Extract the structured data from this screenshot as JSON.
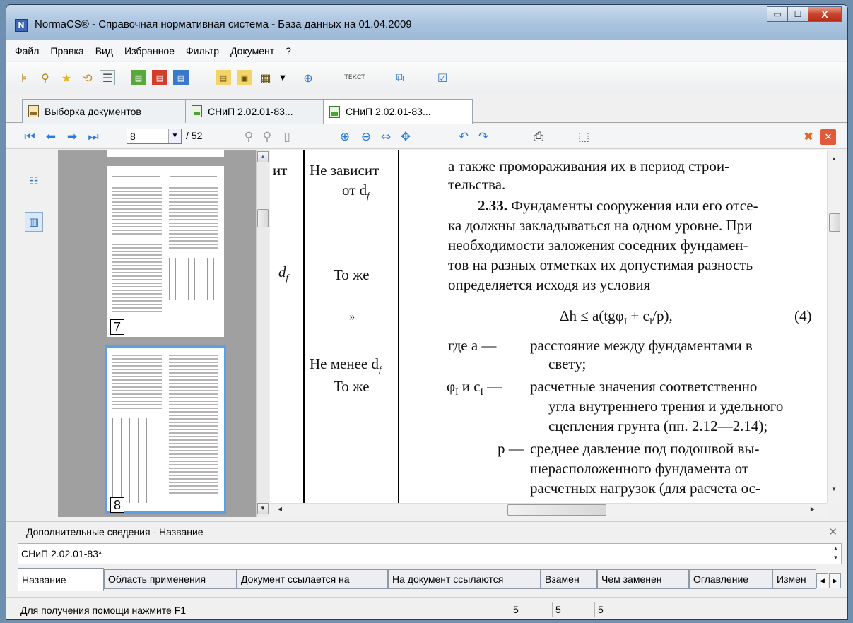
{
  "window": {
    "title": "NormaCS® - Справочная нормативная система - База данных на 01.04.2009"
  },
  "window_controls": {
    "minimize": "▭",
    "maximize": "☐",
    "close": "X"
  },
  "menu": [
    "Файл",
    "Правка",
    "Вид",
    "Избранное",
    "Фильтр",
    "Документ",
    "?"
  ],
  "toolbar_icons": [
    "tree-icon",
    "search-binoculars-icon",
    "favorites-star-icon",
    "history-icon",
    "list-view-icon",
    "doc-green-icon",
    "doc-red-icon",
    "doc-blue-icon",
    "doc-yellow-icon",
    "doc-copy-icon",
    "doc-properties-icon",
    "dropdown-arrow-icon",
    "hierarchy-add-icon",
    "text-icon",
    "compare-icon",
    "check-doc-icon"
  ],
  "toolbar": {
    "text_label": "ТЕКСТ"
  },
  "tabs": [
    {
      "label": "Выборка документов"
    },
    {
      "label": "СНиП 2.02.01-83..."
    },
    {
      "label": "СНиП 2.02.01-83..."
    }
  ],
  "nav": {
    "current_page": "8",
    "total": "/ 52"
  },
  "thumbnails": [
    {
      "page": "7"
    },
    {
      "page": "8"
    }
  ],
  "doc": {
    "col_a1": "ит",
    "col_a2": "d",
    "col_a2_sub": "f",
    "col_b1": "Не зависит",
    "col_b2": "от d",
    "col_b2_sub": "f",
    "col_b3": "То же",
    "col_b4": "»",
    "col_b5": "Не менее d",
    "col_b5_sub": "f",
    "col_b6": "То же",
    "r1": "а также промораживания их в период строи-",
    "r2": "тельства.",
    "r3_bold": "2.33.",
    "r3": " Фундаменты сооружения или его отсе-",
    "r4": "ка должны закладываться на одном уровне. При",
    "r5": "необходимости заложения соседних фундамен-",
    "r6": "тов на разных отметках их допустимая разность",
    "r7": "определяется исходя из условия",
    "formula": "Δh ≤ a(tgφ",
    "formula_sub1": "I",
    "formula_mid": " + c",
    "formula_sub2": "I",
    "formula_end": "/p),",
    "formula_num": "(4)",
    "w1_term": "где  a —",
    "w1": "расстояние между фундаментами в",
    "w1b": "свету;",
    "w2_term": "φ",
    "w2_sub": "I",
    "w2_mid": " и c",
    "w2_sub2": "I",
    "w2_dash": " —",
    "w2": "расчетные значения соответственно",
    "w2b": "угла внутреннего трения и удельного",
    "w2c": "сцепления грунта (пп. 2.12—2.14);",
    "w3_term": "p —",
    "w3": "среднее давление под подошвой вы-",
    "w3b": "шерасположенного фундамента от",
    "w3c": "расчетных нагрузок (для расчета ос-"
  },
  "info": {
    "header": "Дополнительные сведения - Название",
    "value": "СНиП 2.02.01-83*"
  },
  "bottom_tabs": [
    "Название",
    "Область применения",
    "Документ ссылается на",
    "На документ ссылаются",
    "Взамен",
    "Чем заменен",
    "Оглавление",
    "Измен"
  ],
  "status": {
    "help": "Для получения помощи нажмите F1",
    "c1": "5",
    "c2": "5",
    "c3": "5"
  },
  "colors": {
    "accent": "#2c79d6",
    "close_red": "#c9442c",
    "thumb_selected": "#5aa0e6"
  }
}
